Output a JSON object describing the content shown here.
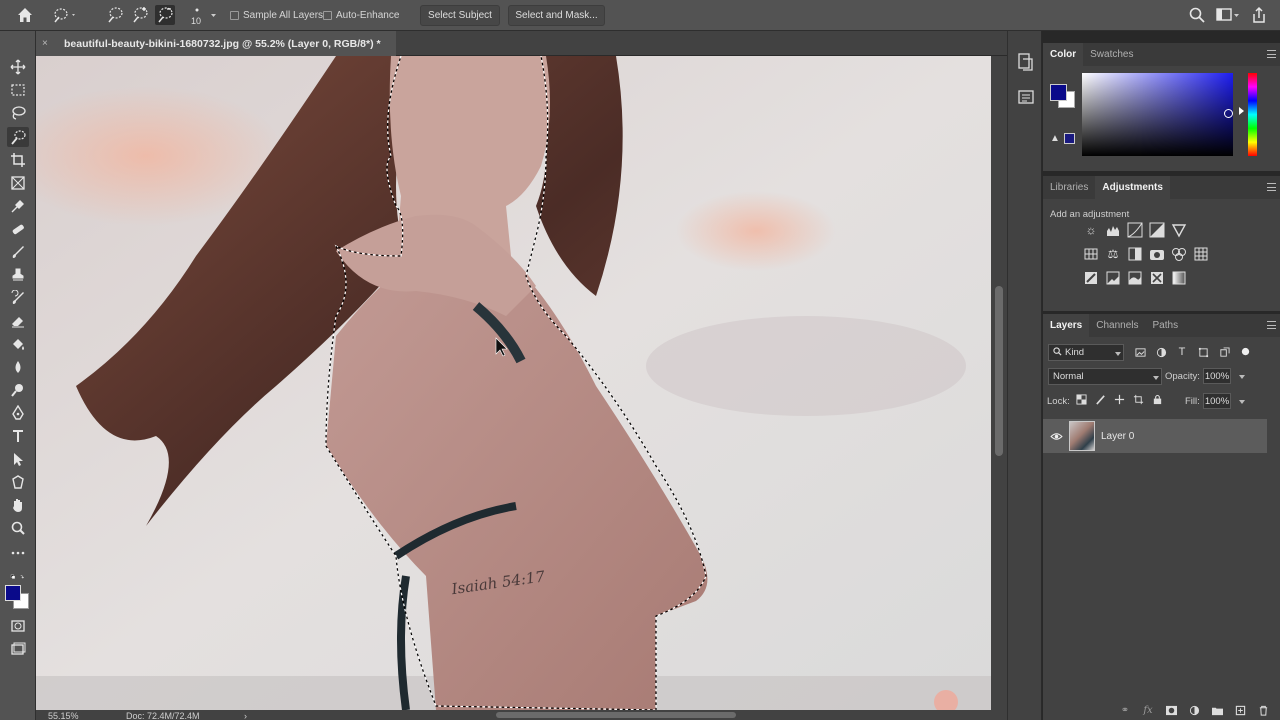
{
  "options_bar": {
    "brush_size": "10",
    "sample_all_layers_label": "Sample All Layers",
    "auto_enhance_label": "Auto-Enhance",
    "select_subject_label": "Select Subject",
    "select_and_mask_label": "Select and Mask..."
  },
  "document": {
    "tab_title": "beautiful-beauty-bikini-1680732.jpg @ 55.2% (Layer 0, RGB/8*) *",
    "close_glyph": "×"
  },
  "status_bar": {
    "zoom": "55.15%",
    "doc_size": "Doc: 72.4M/72.4M"
  },
  "color_panel": {
    "tabs": [
      "Color",
      "Swatches"
    ],
    "foreground_color": "#0a0a8a",
    "background_color": "#ffffff"
  },
  "adjustments_panel": {
    "tabs": [
      "Libraries",
      "Adjustments"
    ],
    "add_label": "Add an adjustment"
  },
  "layers_panel": {
    "tabs": [
      "Layers",
      "Channels",
      "Paths"
    ],
    "filter_kind": "Kind",
    "blend_mode": "Normal",
    "opacity_label": "Opacity:",
    "opacity_value": "100%",
    "lock_label": "Lock:",
    "fill_label": "Fill:",
    "fill_value": "100%",
    "layers": [
      {
        "name": "Layer 0",
        "visible": true
      }
    ]
  },
  "colors": {
    "accent_selection": "#0a0a8a"
  }
}
